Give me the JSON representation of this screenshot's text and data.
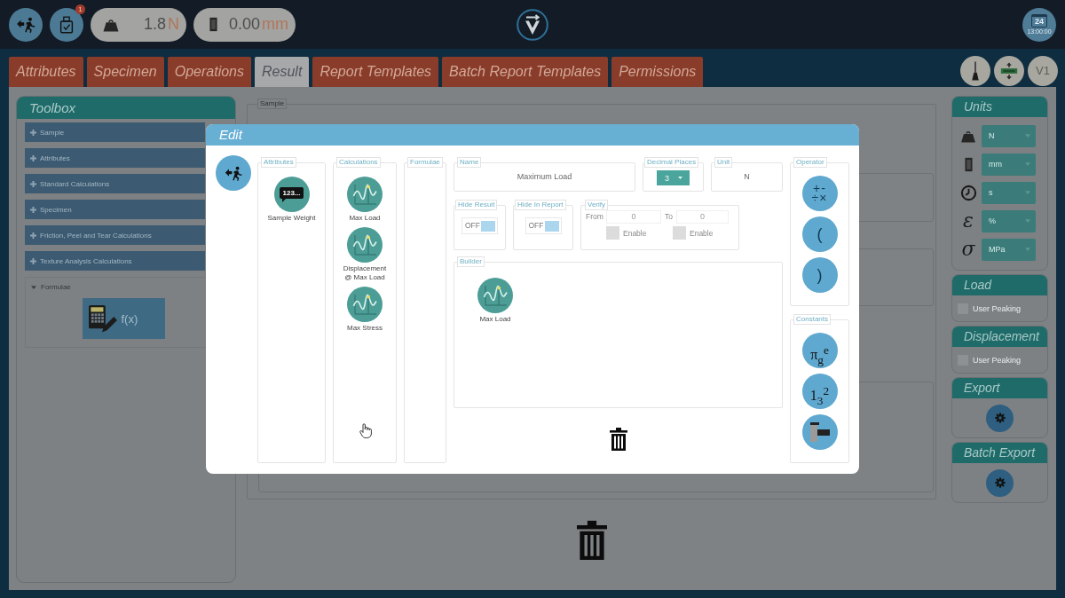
{
  "top_bar": {
    "readouts": [
      {
        "kind": "load",
        "value": "1.8",
        "unit": "N"
      },
      {
        "kind": "displacement",
        "value": "0.00",
        "unit": "mm"
      }
    ],
    "device_badge": "1",
    "clock": {
      "day": "24",
      "time": "13:00:00"
    }
  },
  "tabs": [
    {
      "label": "Attributes",
      "selected": false
    },
    {
      "label": "Specimen",
      "selected": false
    },
    {
      "label": "Operations",
      "selected": false
    },
    {
      "label": "Result",
      "selected": true
    },
    {
      "label": "Report Templates",
      "selected": false
    },
    {
      "label": "Batch Report Templates",
      "selected": false
    },
    {
      "label": "Permissions",
      "selected": false
    }
  ],
  "tab_actions": [
    {
      "kind": "broom"
    },
    {
      "kind": "resize"
    },
    {
      "kind": "text",
      "label": "V1"
    }
  ],
  "toolbox": {
    "title": "Toolbox",
    "groups": [
      {
        "label": "Sample",
        "expanded": false
      },
      {
        "label": "Attributes",
        "expanded": false
      },
      {
        "label": "Standard Calculations",
        "expanded": false
      },
      {
        "label": "Specimen",
        "expanded": false
      },
      {
        "label": "Friction, Peel and Tear Calculations",
        "expanded": false
      },
      {
        "label": "Texture Analysis Calculations",
        "expanded": false
      },
      {
        "label": "Formulae",
        "expanded": true,
        "tools": [
          {
            "label": "f(x)"
          }
        ]
      }
    ]
  },
  "result": {
    "legend": "Sample"
  },
  "side_panels": [
    {
      "kind": "units",
      "title": "Units",
      "rows": [
        {
          "kind": "weight",
          "value": "N"
        },
        {
          "kind": "block",
          "value": "mm"
        },
        {
          "kind": "clock",
          "value": "s"
        },
        {
          "kind": "symbol",
          "symbol": "ε",
          "value": "%"
        },
        {
          "kind": "symbol",
          "symbol": "σ",
          "value": "MPa"
        }
      ]
    },
    {
      "kind": "option",
      "title": "Load",
      "option": {
        "label": "User Peaking",
        "checked": false
      }
    },
    {
      "kind": "option",
      "title": "Displacement",
      "option": {
        "label": "User Peaking",
        "checked": false
      }
    },
    {
      "kind": "action",
      "title": "Export"
    },
    {
      "kind": "action",
      "title": "Batch Export"
    }
  ],
  "edit_dialog": {
    "title": "Edit",
    "attributes": {
      "legend": "Attributes",
      "items": [
        {
          "label": "Sample Weight",
          "icon_text": "123..."
        }
      ]
    },
    "calculations": {
      "legend": "Calculations",
      "items": [
        {
          "label": "Max Load"
        },
        {
          "label": "Displacement @ Max Load"
        },
        {
          "label": "Max Stress"
        }
      ]
    },
    "formulae": {
      "legend": "Formulae"
    },
    "name": {
      "legend": "Name",
      "value": "Maximum Load"
    },
    "decimal_places": {
      "legend": "Decimal Places",
      "value": "3"
    },
    "unit": {
      "legend": "Unit",
      "value": "N"
    },
    "hide_result": {
      "legend": "Hide Result",
      "label": "OFF",
      "on": false
    },
    "hide_in_report": {
      "legend": "Hide In Report",
      "label": "OFF",
      "on": false
    },
    "verify": {
      "legend": "Verify",
      "fields": [
        {
          "label": "From",
          "value": "0",
          "checkbox_label": "Enable",
          "checked": false
        },
        {
          "label": "To",
          "value": "0",
          "checkbox_label": "Enable",
          "checked": false
        }
      ]
    },
    "builder": {
      "legend": "Builder",
      "items": [
        {
          "label": "Max Load"
        }
      ]
    },
    "operator": {
      "legend": "Operator",
      "buttons": [
        {
          "kind": "stacked",
          "lines": [
            "+-",
            "÷×"
          ]
        },
        {
          "kind": "text",
          "label": "("
        },
        {
          "kind": "text",
          "label": ")"
        }
      ]
    },
    "constants": {
      "legend": "Constants",
      "buttons": [
        {
          "kind": "rich",
          "label": "π$_{g}$$^{e}$"
        },
        {
          "kind": "rich",
          "label": "1$_{3}$$^{2}$"
        },
        {
          "kind": "blocks"
        }
      ]
    }
  }
}
